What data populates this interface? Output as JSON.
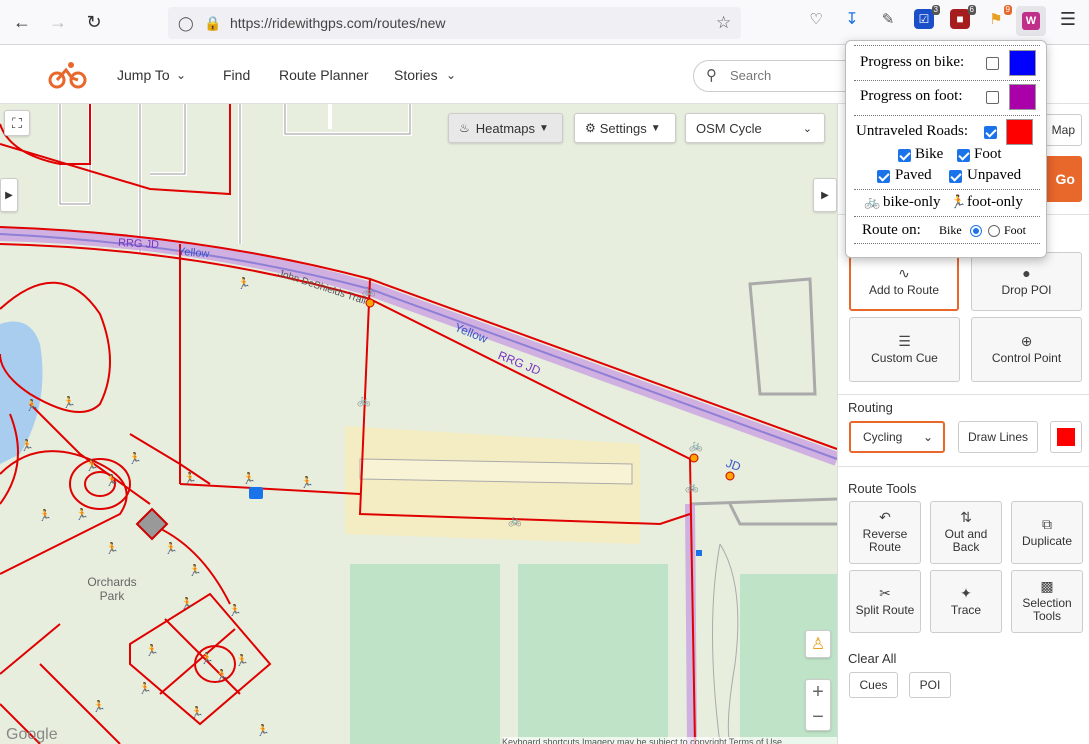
{
  "browser": {
    "url": "https://ridewithgps.com/routes/new",
    "badges": {
      "ext1": "3",
      "ext2": "6",
      "ext3": "9"
    }
  },
  "header": {
    "nav": [
      "Jump To",
      "Find",
      "Route Planner",
      "Stories"
    ],
    "search_placeholder": "Search"
  },
  "map": {
    "heatmaps": "Heatmaps",
    "settings": "Settings",
    "layer": "OSM Cycle",
    "labels": {
      "rrgjd1": "RRG JD",
      "yellow1": "Yellow",
      "john": "John DeShields Trail",
      "yellow2": "Yellow",
      "rrgjd2": "RRG JD",
      "jd": "JD",
      "park": "Orchards Park",
      "google": "Google",
      "attrib": "Keyboard shortcuts   Imagery may be subject to copyright   Terms of Use"
    }
  },
  "panel": {
    "map_btn": "Map",
    "go_btn": "Go",
    "tools": {
      "add_to_route": "Add to Route",
      "drop_poi": "Drop POI",
      "custom_cue": "Custom Cue",
      "control_point": "Control Point"
    },
    "routing_label": "Routing",
    "routing_mode": "Cycling",
    "draw_lines": "Draw Lines",
    "route_tools_label": "Route Tools",
    "route_tools": [
      "Reverse Route",
      "Out and Back",
      "Duplicate",
      "Split Route",
      "Trace",
      "Selection Tools"
    ],
    "clear_all_label": "Clear All",
    "clear_cues": "Cues",
    "clear_poi": "POI",
    "colors": {
      "accent": "#e8672b",
      "route_red": "#ff0000"
    }
  },
  "popup": {
    "progress_bike": "Progress on bike:",
    "progress_foot": "Progress on foot:",
    "untraveled": "Untraveled Roads:",
    "bike": "Bike",
    "foot": "Foot",
    "paved": "Paved",
    "unpaved": "Unpaved",
    "bike_only": "bike-only",
    "foot_only": "foot-only",
    "route_on": "Route on:",
    "route_bike": "Bike",
    "route_foot": "Foot",
    "colors": {
      "bike": "#0000ff",
      "foot": "#aa00aa",
      "untraveled": "#ff0000"
    },
    "checked": {
      "progress_bike": false,
      "progress_foot": false,
      "untraveled": true,
      "bike": true,
      "foot": true,
      "paved": true,
      "unpaved": true
    },
    "route_on_selected": "Foot"
  }
}
